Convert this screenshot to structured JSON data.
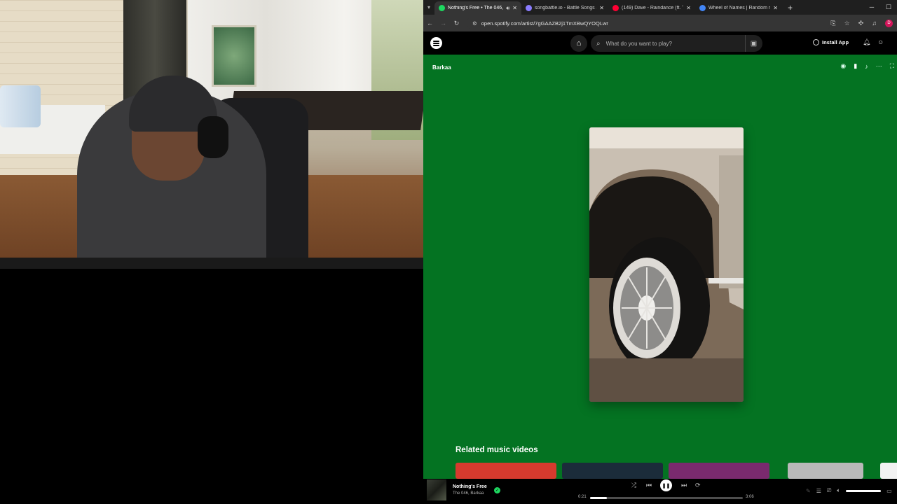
{
  "browser": {
    "tabs": [
      {
        "title": "Nothing's Free • The 046, B",
        "favicon_color": "#1ed760",
        "active": true,
        "has_audio": true
      },
      {
        "title": "songbattle.io - Battle Songs ag",
        "favicon_color": "#8a7cff",
        "active": false
      },
      {
        "title": "(149) Dave - Raindance (ft. Tem",
        "favicon_color": "#ff0033",
        "active": false
      },
      {
        "title": "Wheel of Names | Random nam",
        "favicon_color": "#4285f4",
        "active": false
      }
    ],
    "new_tab_icon": "plus-icon",
    "url": "open.spotify.com/artist/7gGAAZB2j1TmXBwQYOQLwr",
    "profile_initial": "D"
  },
  "spotify": {
    "search_placeholder": "What do you want to play?",
    "install_label": "Install App",
    "artist_name": "Barkaa",
    "related_title": "Related music videos",
    "related_thumb_colors": [
      "#d63a2e",
      "#1b2c3a",
      "#7a2a6e",
      "#b9b9b9",
      "#f2f2f2"
    ],
    "now_playing": {
      "title": "Nothing's Free",
      "artists": "The 046, Barkaa",
      "elapsed": "0:21",
      "duration": "3:06",
      "progress": 0.11
    },
    "accent": "#1ed760",
    "page_bg": "#047322"
  }
}
